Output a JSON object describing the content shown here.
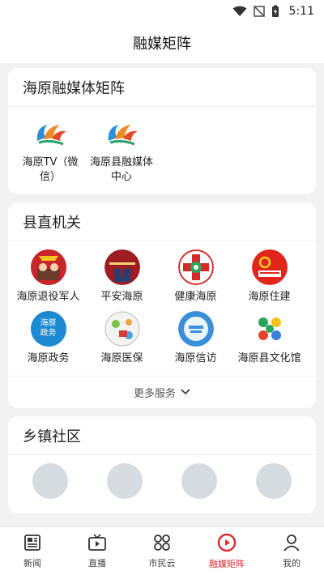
{
  "status_bar": {
    "time": "5:11"
  },
  "header": {
    "title": "融媒矩阵"
  },
  "sections": {
    "matrix": {
      "title": "海原融媒体矩阵",
      "items": [
        {
          "label": "海原TV（微信）",
          "icon": "haiyuan-media-logo"
        },
        {
          "label": "海原县融媒体中心",
          "icon": "haiyuan-media-logo"
        }
      ]
    },
    "county": {
      "title": "县直机关",
      "items": [
        {
          "label": "海原退役军人",
          "icon": "veterans-logo"
        },
        {
          "label": "平安海原",
          "icon": "ping-an-logo"
        },
        {
          "label": "健康海原",
          "icon": "health-cross-logo"
        },
        {
          "label": "海原住建",
          "icon": "housing-party-logo"
        },
        {
          "label": "海原政务",
          "icon": "government-logo",
          "logo_text": "海原政务"
        },
        {
          "label": "海原医保",
          "icon": "medical-insurance-logo"
        },
        {
          "label": "海原信访",
          "icon": "petition-logo"
        },
        {
          "label": "海原县文化馆",
          "icon": "culture-center-logo"
        }
      ],
      "more_label": "更多服务"
    },
    "towns": {
      "title": "乡镇社区"
    }
  },
  "tabbar": {
    "items": [
      {
        "label": "新闻",
        "icon": "news-icon",
        "active": false
      },
      {
        "label": "直播",
        "icon": "tv-live-icon",
        "active": false
      },
      {
        "label": "市民云",
        "icon": "grid-cloud-icon",
        "active": false
      },
      {
        "label": "融媒矩阵",
        "icon": "play-circle-icon",
        "active": true
      },
      {
        "label": "我的",
        "icon": "profile-icon",
        "active": false
      }
    ]
  },
  "colors": {
    "accent": "#e0282d",
    "background": "#f2f2f2",
    "card": "#ffffff"
  }
}
